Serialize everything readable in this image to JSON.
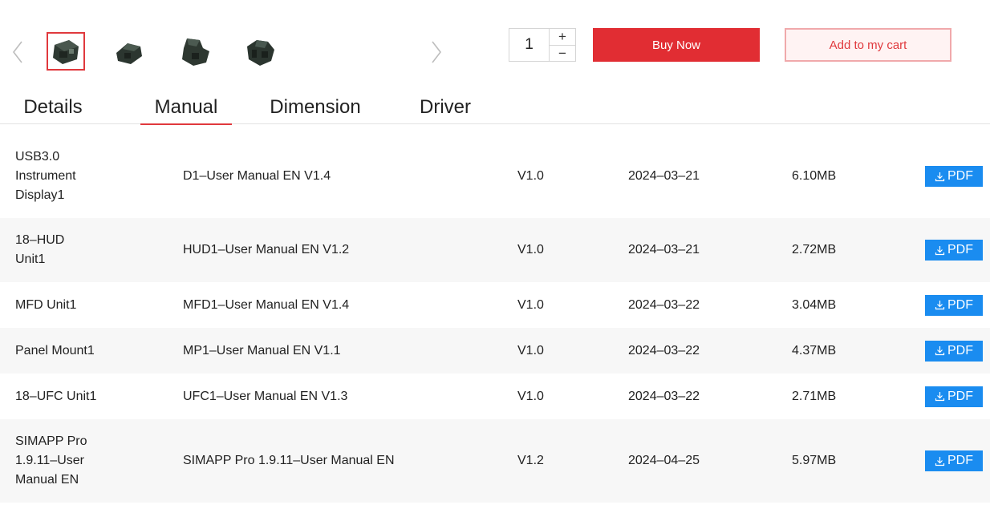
{
  "purchase": {
    "quantity": "1",
    "plus_label": "+",
    "minus_label": "−",
    "buy_now_label": "Buy Now",
    "add_to_cart_label": "Add to my cart"
  },
  "colors": {
    "accent_red": "#e12d33",
    "pdf_blue": "#1a8cf0",
    "alt_row": "#f7f7f7"
  },
  "tabs": [
    {
      "label": "Details",
      "active": false
    },
    {
      "label": "Manual",
      "active": true
    },
    {
      "label": "Dimension",
      "active": false
    },
    {
      "label": "Driver",
      "active": false
    }
  ],
  "manuals": [
    {
      "product": "USB3.0 Instrument Display1",
      "file": "D1–User Manual EN V1.4",
      "version": "V1.0",
      "date": "2024–03–21",
      "size": "6.10MB",
      "download_label": "PDF"
    },
    {
      "product": "18–HUD Unit1",
      "file": "HUD1–User Manual EN V1.2",
      "version": "V1.0",
      "date": "2024–03–21",
      "size": "2.72MB",
      "download_label": "PDF"
    },
    {
      "product": "MFD Unit1",
      "file": "MFD1–User Manual EN V1.4",
      "version": "V1.0",
      "date": "2024–03–22",
      "size": "3.04MB",
      "download_label": "PDF"
    },
    {
      "product": "Panel Mount1",
      "file": "MP1–User Manual EN V1.1",
      "version": "V1.0",
      "date": "2024–03–22",
      "size": "4.37MB",
      "download_label": "PDF"
    },
    {
      "product": "18–UFC Unit1",
      "file": "UFC1–User Manual EN V1.3",
      "version": "V1.0",
      "date": "2024–03–22",
      "size": "2.71MB",
      "download_label": "PDF"
    },
    {
      "product": "SIMAPP Pro 1.9.11–User Manual EN",
      "file": "SIMAPP Pro 1.9.11–User Manual EN",
      "version": "V1.2",
      "date": "2024–04–25",
      "size": "5.97MB",
      "download_label": "PDF"
    }
  ]
}
